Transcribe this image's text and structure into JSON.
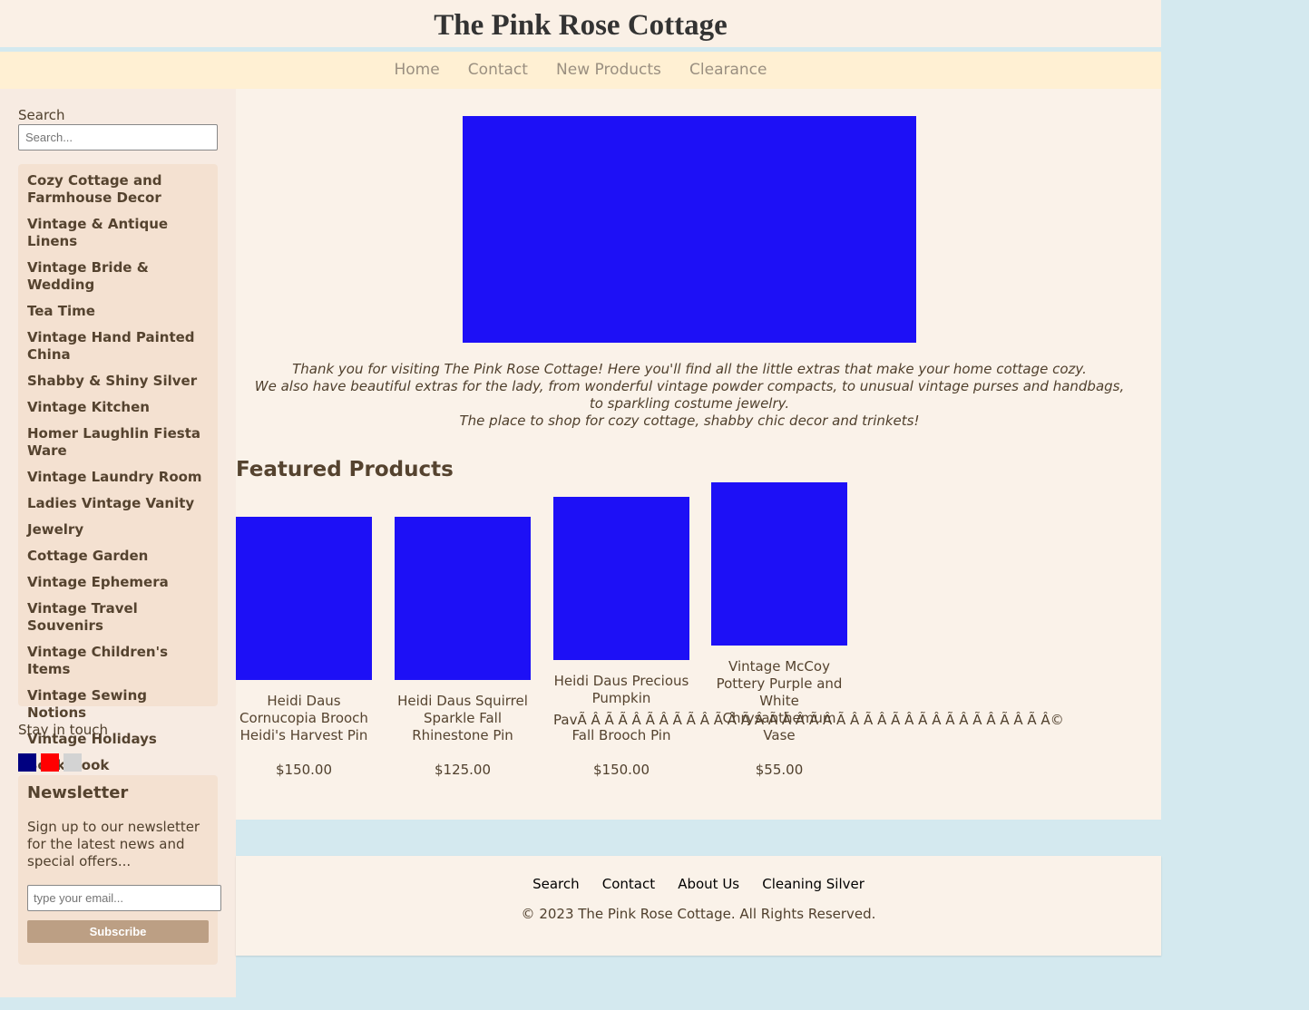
{
  "site": {
    "title": "The Pink Rose Cottage"
  },
  "nav": [
    {
      "label": "Home"
    },
    {
      "label": "Contact"
    },
    {
      "label": "New Products"
    },
    {
      "label": "Clearance"
    }
  ],
  "sidebar": {
    "search_label": "Search",
    "search_placeholder": "Search...",
    "categories": [
      "Cozy Cottage and Farmhouse Decor",
      "Vintage & Antique Linens",
      "Vintage Bride & Wedding",
      "Tea Time",
      "Vintage Hand Painted China",
      "Shabby & Shiny Silver",
      "Vintage Kitchen",
      "Homer Laughlin Fiesta Ware",
      "Vintage Laundry Room",
      "Ladies Vintage Vanity",
      "Jewelry",
      "Cottage Garden",
      "Vintage Ephemera",
      "Vintage Travel Souvenirs",
      "Vintage Children's Items",
      "Vintage Sewing Notions",
      "Vintage Holidays",
      "Book Nook"
    ],
    "stay_in_touch": "Stay in touch",
    "social": [
      {
        "icon": "facebook-icon",
        "color": "#000080"
      },
      {
        "icon": "pinterest-icon",
        "color": "#ff0000"
      },
      {
        "icon": "email-icon",
        "color": "#d3d3d3"
      }
    ],
    "newsletter": {
      "title": "Newsletter",
      "text": "Sign up to our newsletter for the latest news and special offers...",
      "email_placeholder": "type your email...",
      "button_label": "Subscribe"
    }
  },
  "main": {
    "intro": [
      "Thank you for visiting The Pink Rose Cottage! Here you'll find all the little extras that make your home cottage cozy.",
      "We also have beautiful extras for the lady, from wonderful vintage powder compacts, to unusual vintage purses and handbags, to sparkling costume jewelry.",
      "The place to shop for cozy cottage, shabby chic decor and trinkets!"
    ],
    "featured_title": "Featured Products",
    "products": [
      {
        "name": "Heidi Daus Cornucopia Brooch Heidi's Harvest Pin",
        "price": "$150.00"
      },
      {
        "name": "Heidi Daus Squirrel Sparkle Fall Rhinestone Pin",
        "price": "$125.00"
      },
      {
        "name": "Heidi Daus Precious Pumpkin",
        "name_line2": "Fall Brooch Pin",
        "price": "$150.00"
      },
      {
        "name": "Vintage McCoy Pottery Purple and White Chrysanthemum Vase",
        "price": "$55.00"
      }
    ],
    "garbled_text": "PavÃ  Â  Ã  Ã  Â  Ã  Â  Ã  Ã  Â  Ã  Â  Ã  Â  Ã  Ã  Â  Ã  Â  Ã  Â  Ã  Â  Ã  Â  Ã  Â  Ã  Â  Ã  Â  Ã  Â  Ã  Â©"
  },
  "footer": {
    "links": [
      "Search",
      "Contact",
      "About Us",
      "Cleaning Silver"
    ],
    "copyright": "© 2023 The Pink Rose Cottage. All Rights Reserved."
  },
  "colors": {
    "image_placeholder": "#1d10f6",
    "page_background": "#d4e9ef",
    "header_background": "#faf0e6",
    "nav_background": "#fff0d3",
    "subscribe_button": "#bc9f84"
  }
}
